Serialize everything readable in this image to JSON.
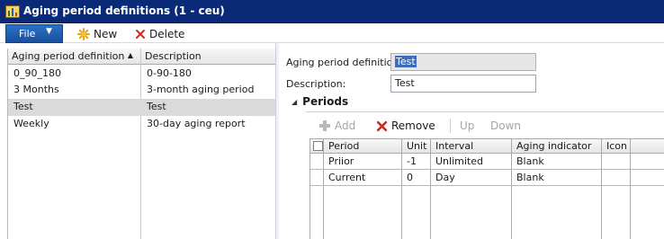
{
  "window": {
    "title": "Aging period definitions (1 - ceu)"
  },
  "toolbar": {
    "file_label": "File",
    "new_label": "New",
    "delete_label": "Delete"
  },
  "list": {
    "columns": [
      "Aging period definition",
      "Description"
    ],
    "rows": [
      {
        "definition": "0_90_180",
        "description": "0-90-180"
      },
      {
        "definition": "3 Months",
        "description": "3-month aging period"
      },
      {
        "definition": "Test",
        "description": "Test"
      },
      {
        "definition": "Weekly",
        "description": "30-day aging report"
      }
    ],
    "selected_index": 2
  },
  "form": {
    "definition_label": "Aging period definition:",
    "definition_value": "Test",
    "description_label": "Description:",
    "description_value": "Test"
  },
  "periods": {
    "section_title": "Periods",
    "add_label": "Add",
    "remove_label": "Remove",
    "up_label": "Up",
    "down_label": "Down",
    "columns": [
      "Period",
      "Unit",
      "Interval",
      "Aging indicator",
      "Icon"
    ],
    "rows": [
      {
        "period": "Priior",
        "unit": "-1",
        "interval": "Unlimited",
        "indicator": "Blank",
        "icon": ""
      },
      {
        "period": "Current",
        "unit": "0",
        "interval": "Day",
        "indicator": "Blank",
        "icon": ""
      }
    ]
  },
  "colors": {
    "title_bar": "#0a2a78",
    "file_button": "#1f5fb3",
    "selection": "#dadada",
    "remove_red": "#d22a1e"
  }
}
